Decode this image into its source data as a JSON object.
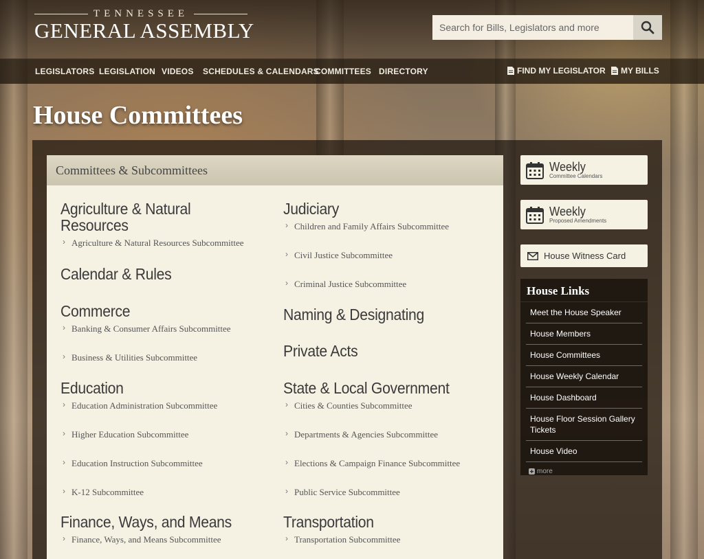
{
  "header": {
    "logo_top": "TENNESSEE",
    "logo_main": "GENERAL ASSEMBLY",
    "search_placeholder": "Search for Bills, Legislators and more"
  },
  "nav": {
    "items": [
      "LEGISLATORS",
      "LEGISLATION",
      "VIDEOS",
      "SCHEDULES & CALENDARS",
      "COMMITTEES",
      "DIRECTORY"
    ],
    "find_legislator": "FIND MY LEGISLATOR",
    "my_bills": "MY BILLS"
  },
  "page": {
    "title": "House Committees",
    "panel_title": "Committees & Subcommittees"
  },
  "committees": {
    "left": [
      {
        "title": "Agriculture & Natural Resources",
        "title_line1": "Agriculture & Natural",
        "title_line2": "Resources",
        "subs": [
          "Agriculture & Natural Resources Subcommittee"
        ]
      },
      {
        "title": "Calendar & Rules",
        "subs": []
      },
      {
        "title": "Commerce",
        "subs": [
          "Banking & Consumer Affairs Subcommittee",
          "Business & Utilities Subcommittee"
        ]
      },
      {
        "title": "Education",
        "subs": [
          "Education Administration Subcommittee",
          "Higher Education Subcommittee",
          "Education Instruction Subcommittee",
          "K-12 Subcommittee"
        ]
      },
      {
        "title": "Finance, Ways, and Means",
        "subs": [
          "Finance, Ways, and Means Subcommittee"
        ]
      }
    ],
    "right": [
      {
        "title": "Judiciary",
        "subs": [
          "Children and Family Affairs Subcommittee",
          "Civil Justice Subcommittee",
          "Criminal Justice Subcommittee"
        ]
      },
      {
        "title": "Naming & Designating",
        "subs": []
      },
      {
        "title": "Private Acts",
        "subs": []
      },
      {
        "title": "State & Local Government",
        "subs": [
          "Cities & Counties Subcommittee",
          "Departments & Agencies Subcommittee",
          "Elections & Campaign Finance Subcommittee",
          "Public Service Subcommittee"
        ]
      },
      {
        "title": "Transportation",
        "subs": [
          "Transportation Subcommittee"
        ]
      }
    ]
  },
  "sidebar": {
    "calendars_big": "Weekly",
    "calendars_small": "Committee Calendars",
    "amendments_big": "Weekly",
    "amendments_small": "Proposed Amendments",
    "witness": "House Witness Card",
    "links_title": "House Links",
    "links": [
      "Meet the House Speaker",
      "House Members",
      "House Committees",
      "House Weekly Calendar",
      "House Dashboard",
      "House Floor Session Gallery Tickets",
      "House Video"
    ],
    "more": "more"
  },
  "colors": {
    "panel_bg": "#f5f1e3",
    "nav_bg": "#231910",
    "text_dark": "#3a3a3a"
  }
}
